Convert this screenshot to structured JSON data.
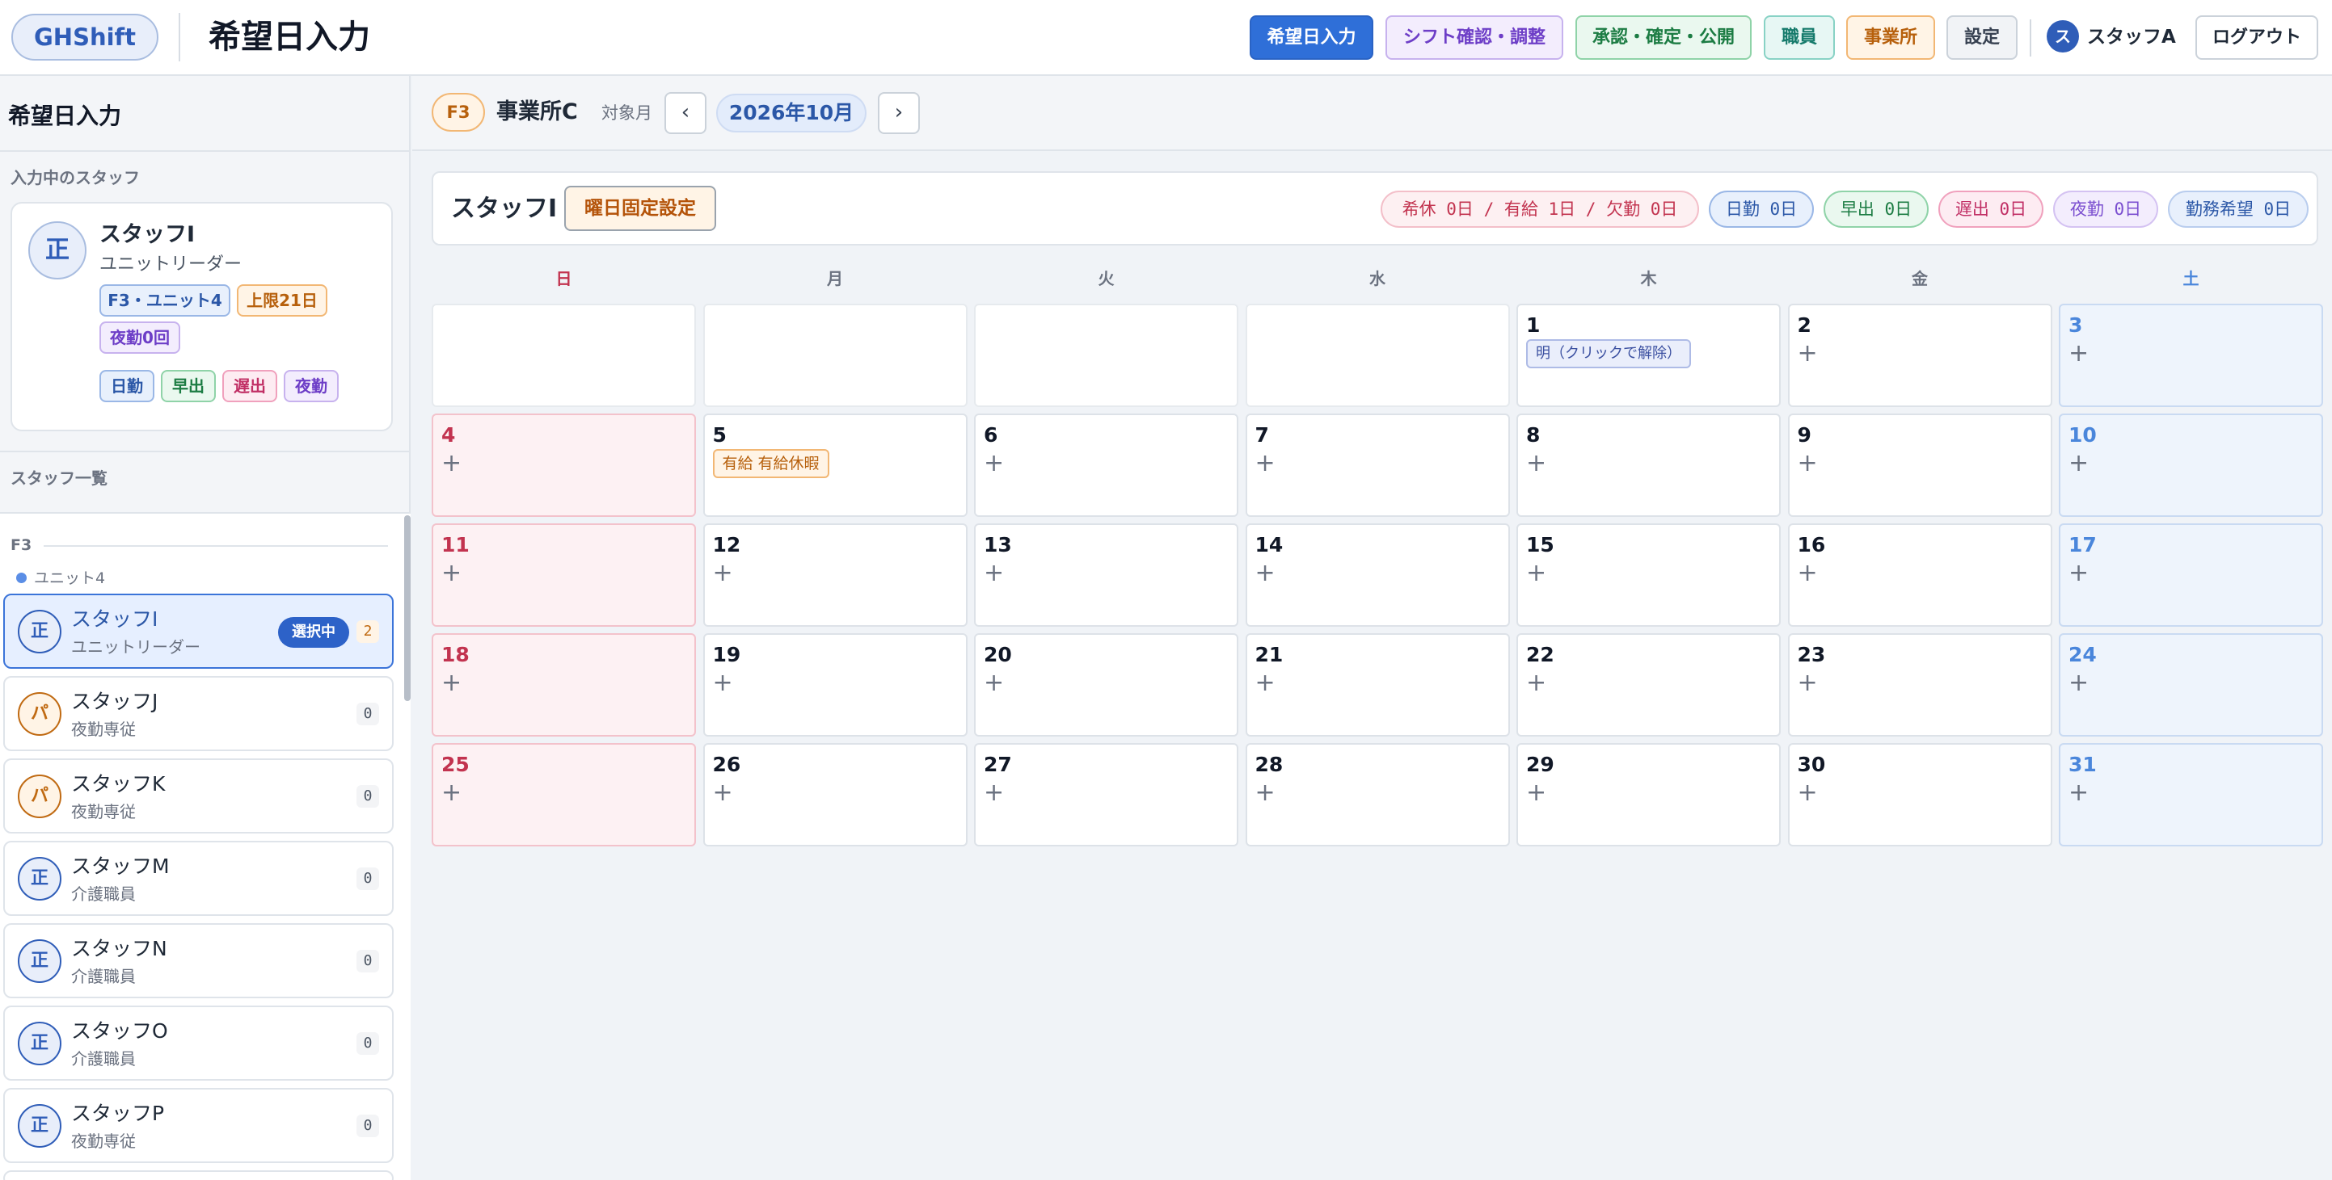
{
  "header": {
    "logo": "GHShift",
    "title": "希望日入力",
    "nav": [
      {
        "label": "希望日入力",
        "active": true
      },
      {
        "label": "シフト確認・調整"
      },
      {
        "label": "承認・確定・公開"
      },
      {
        "label": "職員"
      },
      {
        "label": "事業所"
      },
      {
        "label": "設定"
      }
    ],
    "user_initial": "ス",
    "user_name": "スタッフA",
    "logout": "ログアウト"
  },
  "sidebar": {
    "title": "希望日入力",
    "current_section": "入力中のスタッフ",
    "current": {
      "avatar": "正",
      "name": "スタッフI",
      "role": "ユニットリーダー",
      "badges": [
        "F3・ユニット4",
        "上限21日",
        "夜勤0回"
      ],
      "shift_types": [
        "日勤",
        "早出",
        "遅出",
        "夜勤"
      ]
    },
    "list_section": "スタッフ一覧",
    "group": "F3",
    "unit": "ユニット4",
    "selected_badge": "選択中",
    "staff": [
      {
        "avatar": "正",
        "name": "スタッフI",
        "role": "ユニットリーダー",
        "count": "2",
        "selected": true
      },
      {
        "avatar": "パ",
        "name": "スタッフJ",
        "role": "夜勤専従",
        "count": "0"
      },
      {
        "avatar": "パ",
        "name": "スタッフK",
        "role": "夜勤専従",
        "count": "0"
      },
      {
        "avatar": "正",
        "name": "スタッフM",
        "role": "介護職員",
        "count": "0"
      },
      {
        "avatar": "正",
        "name": "スタッフN",
        "role": "介護職員",
        "count": "0"
      },
      {
        "avatar": "正",
        "name": "スタッフO",
        "role": "介護職員",
        "count": "0"
      },
      {
        "avatar": "正",
        "name": "スタッフP",
        "role": "夜勤専従",
        "count": "0"
      }
    ]
  },
  "toolbar": {
    "office_code": "F3",
    "office_name": "事業所C",
    "month_label": "対象月",
    "prev": "‹",
    "month": "2026年10月",
    "next": "›"
  },
  "staff_bar": {
    "name": "スタッフI",
    "fixed_button": "曜日固定設定",
    "stats": [
      "希休 0日 / 有給 1日 / 欠勤 0日",
      "日勤 0日",
      "早出 0日",
      "遅出 0日",
      "夜勤 0日",
      "勤務希望 0日"
    ]
  },
  "calendar": {
    "weekdays": [
      "日",
      "月",
      "火",
      "水",
      "木",
      "金",
      "土"
    ],
    "plus": "+",
    "weeks": [
      [
        null,
        null,
        null,
        null,
        {
          "day": "1",
          "tag": "明（クリックで解除）"
        },
        {
          "day": "2"
        },
        {
          "day": "3"
        }
      ],
      [
        {
          "day": "4"
        },
        {
          "day": "5",
          "tag": "有給 有給休暇"
        },
        {
          "day": "6"
        },
        {
          "day": "7"
        },
        {
          "day": "8"
        },
        {
          "day": "9"
        },
        {
          "day": "10"
        }
      ],
      [
        {
          "day": "11"
        },
        {
          "day": "12"
        },
        {
          "day": "13"
        },
        {
          "day": "14"
        },
        {
          "day": "15"
        },
        {
          "day": "16"
        },
        {
          "day": "17"
        }
      ],
      [
        {
          "day": "18"
        },
        {
          "day": "19"
        },
        {
          "day": "20"
        },
        {
          "day": "21"
        },
        {
          "day": "22"
        },
        {
          "day": "23"
        },
        {
          "day": "24"
        }
      ],
      [
        {
          "day": "25"
        },
        {
          "day": "26"
        },
        {
          "day": "27"
        },
        {
          "day": "28"
        },
        {
          "day": "29"
        },
        {
          "day": "30"
        },
        {
          "day": "31"
        }
      ]
    ]
  }
}
